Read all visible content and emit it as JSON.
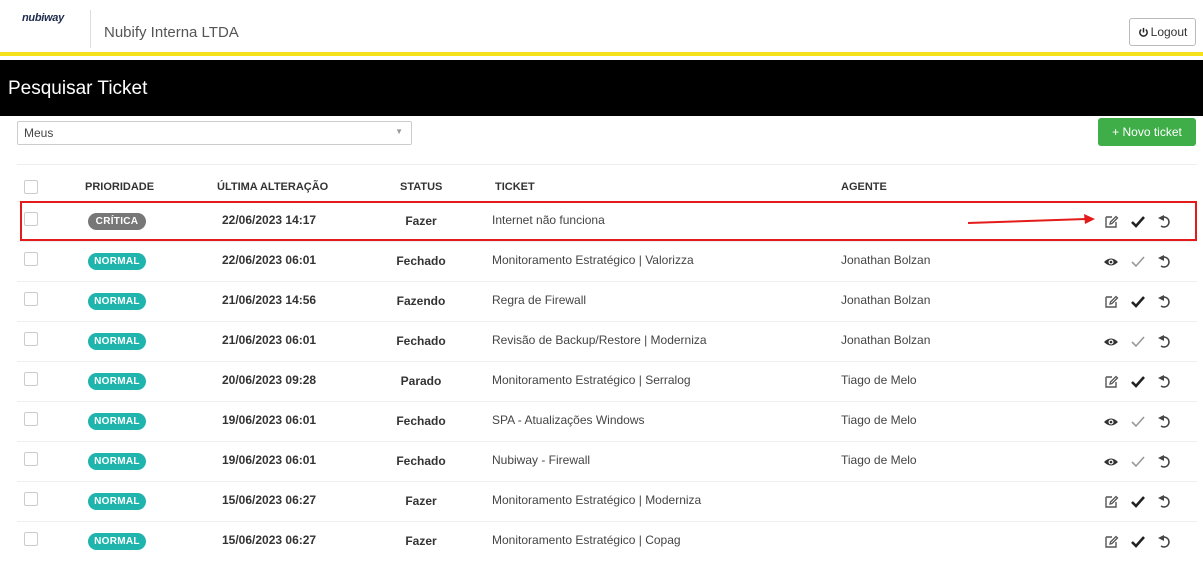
{
  "topbar": {
    "logo": "nubiway",
    "company": "Nubify Interna LTDA",
    "logout_label": "Logout"
  },
  "header": {
    "title": "Pesquisar Ticket"
  },
  "filter": {
    "value": "Meus"
  },
  "new_ticket_label": "+ Novo ticket",
  "columns": {
    "priority": "PRIORIDADE",
    "last_change": "ÚLTIMA ALTERAÇÃO",
    "status": "STATUS",
    "ticket": "TICKET",
    "agent": "AGENTE"
  },
  "rows": [
    {
      "priority": "CRÍTICA",
      "date": "22/06/2023 14:17",
      "status": "Fazer",
      "ticket": "Internet não funciona",
      "agent": "",
      "first_action": "edit-icon",
      "check": "strong"
    },
    {
      "priority": "NORMAL",
      "date": "22/06/2023 06:01",
      "status": "Fechado",
      "ticket": "Monitoramento Estratégico | Valorizza",
      "agent": "Jonathan Bolzan",
      "first_action": "eye-icon",
      "check": "light"
    },
    {
      "priority": "NORMAL",
      "date": "21/06/2023 14:56",
      "status": "Fazendo",
      "ticket": "Regra de Firewall",
      "agent": "Jonathan Bolzan",
      "first_action": "edit-icon",
      "check": "strong"
    },
    {
      "priority": "NORMAL",
      "date": "21/06/2023 06:01",
      "status": "Fechado",
      "ticket": "Revisão de Backup/Restore | Moderniza",
      "agent": "Jonathan Bolzan",
      "first_action": "eye-icon",
      "check": "light"
    },
    {
      "priority": "NORMAL",
      "date": "20/06/2023 09:28",
      "status": "Parado",
      "ticket": "Monitoramento Estratégico | Serralog",
      "agent": "Tiago de Melo",
      "first_action": "edit-icon",
      "check": "strong"
    },
    {
      "priority": "NORMAL",
      "date": "19/06/2023 06:01",
      "status": "Fechado",
      "ticket": "SPA - Atualizações Windows",
      "agent": "Tiago de Melo",
      "first_action": "eye-icon",
      "check": "light"
    },
    {
      "priority": "NORMAL",
      "date": "19/06/2023 06:01",
      "status": "Fechado",
      "ticket": "Nubiway - Firewall",
      "agent": "Tiago de Melo",
      "first_action": "eye-icon",
      "check": "light"
    },
    {
      "priority": "NORMAL",
      "date": "15/06/2023 06:27",
      "status": "Fazer",
      "ticket": "Monitoramento Estratégico | Moderniza",
      "agent": "",
      "first_action": "edit-icon",
      "check": "strong"
    },
    {
      "priority": "NORMAL",
      "date": "15/06/2023 06:27",
      "status": "Fazer",
      "ticket": "Monitoramento Estratégico | Copag",
      "agent": "",
      "first_action": "edit-icon",
      "check": "strong"
    }
  ],
  "colors": {
    "accent_yellow": "#f5e21b",
    "normal_badge": "#1fb5ac",
    "critical_badge": "#777777",
    "new_button": "#3fae49",
    "highlight": "#e41b1b"
  }
}
